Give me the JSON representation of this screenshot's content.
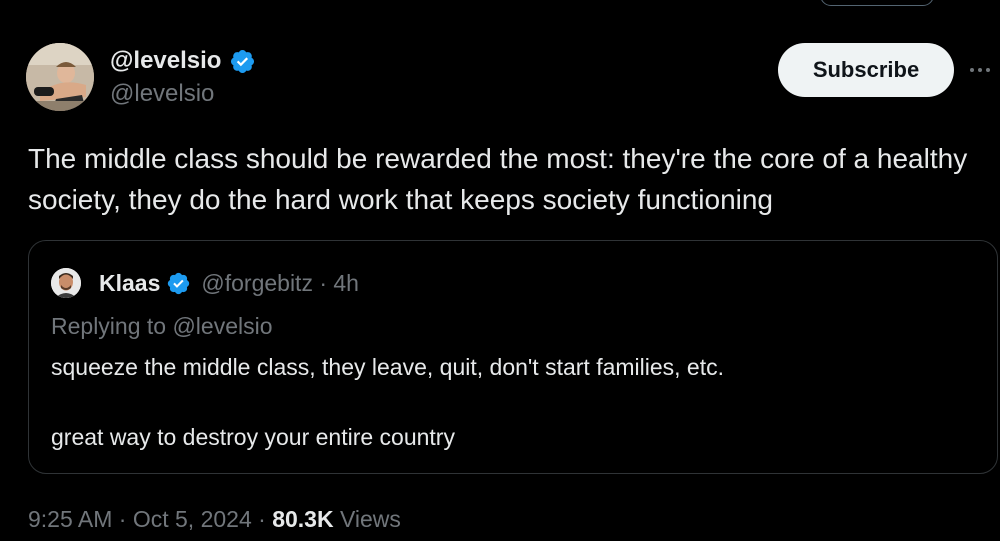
{
  "colors": {
    "background": "#000000",
    "text_primary": "#e7e9ea",
    "text_secondary": "#71767b",
    "verified_badge": "#1d9bf0",
    "button_background": "#eff3f4",
    "card_border": "#2f3336"
  },
  "tweet": {
    "author": {
      "display_name": "@levelsio",
      "handle": "@levelsio",
      "avatar_icon": "avatar-photo",
      "verified_icon": "verified-badge-icon"
    },
    "subscribe_label": "Subscribe",
    "more_icon": "more-horizontal-icon",
    "text": "The middle class should be rewarded the most: they're the core of a healthy society, they do the hard work that keeps society functioning",
    "quote": {
      "display_name": "Klaas",
      "handle_and_time": "@forgebitz · 4h",
      "replying_to": "Replying to @levelsio",
      "line1": "squeeze the middle class, they leave, quit, don't start families, etc.",
      "line2": "great way to destroy your entire country"
    },
    "meta": {
      "time_date": "9:25 AM · Oct 5, 2024 · ",
      "views_count": "80.3K",
      "views_label": " Views"
    }
  }
}
